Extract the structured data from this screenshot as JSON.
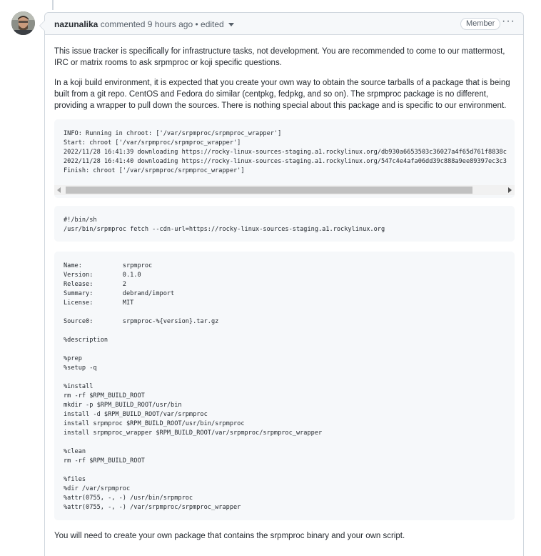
{
  "comment": {
    "author": "nazunalika",
    "action": "commented",
    "time": "9 hours ago",
    "separator": "•",
    "edited_label": "edited",
    "badge": "Member",
    "more_label": "···"
  },
  "body": {
    "paragraph1": "This issue tracker is specifically for infrastructure tasks, not development. You are recommended to come to our mattermost, IRC or matrix rooms to ask srpmproc or koji specific questions.",
    "paragraph2": "In a koji build environment, it is expected that you create your own way to obtain the source tarballs of a package that is being built from a git repo. CentOS and Fedora do similar (centpkg, fedpkg, and so on). The srpmproc package is no different, providing a wrapper to pull down the sources. There is nothing special about this package and is specific to our environment.",
    "code1": "INFO: Running in chroot: ['/var/srpmproc/srpmproc_wrapper']\nStart: chroot ['/var/srpmproc/srpmproc_wrapper']\n2022/11/28 16:41:39 downloading https://rocky-linux-sources-staging.a1.rockylinux.org/db930a6653503c36027a4f65d761f8838c\n2022/11/28 16:41:40 downloading https://rocky-linux-sources-staging.a1.rockylinux.org/547c4e4afa06dd39c888a9ee89397ec3c3\nFinish: chroot ['/var/srpmproc/srpmproc_wrapper']",
    "code2": "#!/bin/sh\n/usr/bin/srpmproc fetch --cdn-url=https://rocky-linux-sources-staging.a1.rockylinux.org",
    "code3": "Name:           srpmproc\nVersion:        0.1.0\nRelease:        2\nSummary:        debrand/import\nLicense:        MIT\n\nSource0:        srpmproc-%{version}.tar.gz\n\n%description\n\n%prep\n%setup -q\n\n%install\nrm -rf $RPM_BUILD_ROOT\nmkdir -p $RPM_BUILD_ROOT/usr/bin\ninstall -d $RPM_BUILD_ROOT/var/srpmproc\ninstall srpmproc $RPM_BUILD_ROOT/usr/bin/srpmproc\ninstall srpmproc_wrapper $RPM_BUILD_ROOT/var/srpmproc/srpmproc_wrapper\n\n%clean\nrm -rf $RPM_BUILD_ROOT\n\n%files\n%dir /var/srpmproc\n%attr(0755, -, -) /usr/bin/srpmproc\n%attr(0755, -, -) /var/srpmproc/srpmproc_wrapper",
    "paragraph3": "You will need to create your own package that contains the srpmproc binary and your own script."
  },
  "icons": {
    "avatar": "avatar-photo",
    "caret": "caret-down-icon",
    "more": "kebab-horizontal-icon",
    "scroll_left": "scroll-left-arrow-icon",
    "scroll_right": "scroll-right-arrow-icon"
  },
  "colors": {
    "header_bg": "#f6f8fa",
    "border": "#d0d7de",
    "code_bg": "#f6f8fa",
    "text": "#24292f",
    "muted": "#57606a"
  }
}
